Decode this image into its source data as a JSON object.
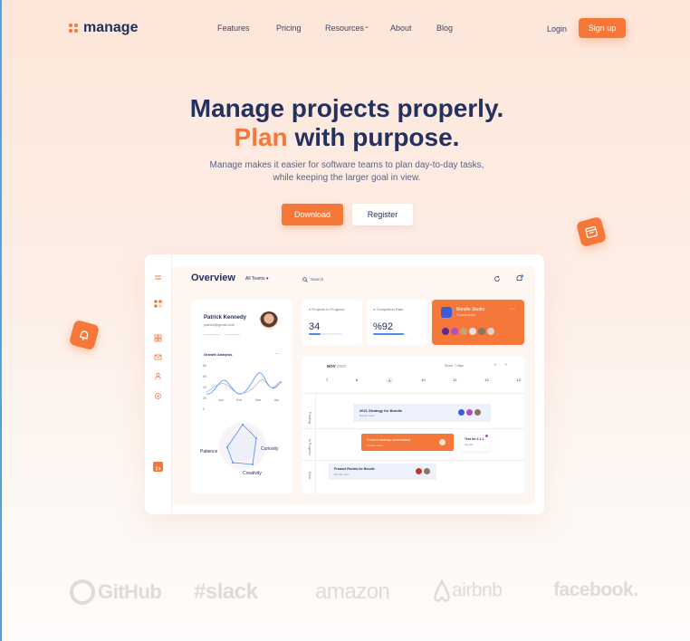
{
  "nav": {
    "logo": "manage",
    "items": [
      "Features",
      "Pricing",
      "Resources",
      "About",
      "Blog"
    ],
    "login": "Login",
    "signup": "Sign up"
  },
  "hero": {
    "title_line1": "Manage projects properly.",
    "title_line2_accent": "Plan",
    "title_line2_rest": " with purpose.",
    "subtitle_line1": "Manage makes it easier for software teams to plan day-to-day tasks,",
    "subtitle_line2": "while keeping the larger goal in view.",
    "download": "Download",
    "register": "Register"
  },
  "dashboard": {
    "title": "Overview",
    "team_filter": "All Teams",
    "search_placeholder": "Search",
    "profile": {
      "name": "Patrick Kennedy",
      "email": "patrick@gmail.com",
      "chart_title": "Growth Analysis",
      "months": [
        "Jan",
        "Feb",
        "Mar",
        "Apr"
      ],
      "y_ticks": [
        "80",
        "60",
        "40",
        "20",
        "0"
      ],
      "skills": [
        "Patience",
        "Curiosity",
        "Creativity"
      ]
    },
    "stats": [
      {
        "title": "Projects In Progress",
        "value": "34",
        "progress": 0.35
      },
      {
        "title": "Completion Rate",
        "value": "%92",
        "progress": 0.92
      }
    ],
    "bundle": {
      "title": "Bundle Studio",
      "subtitle": "Product team"
    },
    "calendar": {
      "month": "NOV",
      "year": "2020",
      "range_label": "Show: 7 days",
      "days": [
        "7",
        "8",
        "9",
        "10",
        "11",
        "12",
        "13"
      ],
      "rows": [
        "Pending",
        "In Progress",
        "Done"
      ],
      "tasks": [
        {
          "title": "2021 Strategy for Bundle",
          "sub": "Bundle team"
        },
        {
          "title": "Product roadmap consolidation",
          "sub": "Product team"
        },
        {
          "title": "Test for 2.1.1",
          "sub": "Bundle"
        },
        {
          "title": "Product Review for Bundle",
          "sub": "Bundle team"
        }
      ]
    }
  },
  "logos": [
    "GitHub",
    "slack",
    "amazon",
    "airbnb",
    "facebook."
  ],
  "colors": {
    "accent": "#f5773a",
    "navy": "#24305e"
  }
}
